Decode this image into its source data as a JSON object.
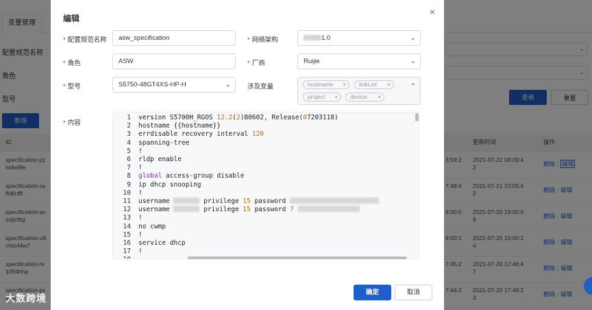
{
  "background": {
    "tab_label": "变量管理",
    "filters": [
      {
        "label": "配置规范名称"
      },
      {
        "label": "角色"
      },
      {
        "label": "型号"
      }
    ],
    "query_button": "查询",
    "reset_button": "重置",
    "new_button": "新增",
    "table": {
      "columns": [
        "ID",
        "更新时间",
        "操作"
      ],
      "rows": [
        {
          "id_line1": "specification-jzj",
          "id_line2": "hnke9le",
          "time_prev_line1": "3:59:2",
          "time_prev_line2": "",
          "updated_line1": "2021-07-22 08:09:4",
          "updated_line2": "2",
          "delete": "删除",
          "edit": "编辑"
        },
        {
          "id_line1": "specification-ox",
          "id_line2": "ffdfinfff",
          "time_prev_line1": "7:48:4",
          "time_prev_line2": "",
          "updated_line1": "2021-07-21 23:05:4",
          "updated_line2": "2",
          "delete": "删除",
          "edit": "编辑"
        },
        {
          "id_line1": "specification-au",
          "id_line2": "zojizfttg",
          "time_prev_line1": "9:00:5",
          "time_prev_line2": "",
          "updated_line1": "2021-07-20 19:00:5",
          "updated_line2": "9",
          "delete": "删除",
          "edit": "编辑"
        },
        {
          "id_line1": "specification-u9",
          "id_line2": "chio44w7",
          "time_prev_line1": "9:00:1",
          "time_prev_line2": "",
          "updated_line1": "2021-07-20 19:00:1",
          "updated_line2": "4",
          "delete": "删除",
          "edit": "编辑"
        },
        {
          "id_line1": "specification-hr",
          "id_line2": "1tf94hha",
          "time_prev_line1": "7:45:2",
          "time_prev_line2": "",
          "updated_line1": "2021-07-20 17:46:4",
          "updated_line2": "7",
          "delete": "删除",
          "edit": "编辑"
        },
        {
          "id_line1": "specification-pc",
          "id_line2": "dqxqc",
          "time_prev_line1": "7:44:2",
          "time_prev_line2": "",
          "updated_line1": "2021-07-20 17:46:2",
          "updated_line2": "3",
          "delete": "删除",
          "edit": "编辑"
        }
      ]
    }
  },
  "modal": {
    "title": "编辑",
    "close_icon": "×",
    "fields": {
      "spec_name": {
        "label": "配置规范名称",
        "required": "*",
        "value": "asw_specification"
      },
      "network_arch": {
        "label": "网络架构",
        "required": "*",
        "value": "1.0"
      },
      "role": {
        "label": "角色",
        "required": "*",
        "value": "ASW"
      },
      "vendor": {
        "label": "厂商",
        "required": "*",
        "value": "Ruijie"
      },
      "model": {
        "label": "型号",
        "required": "*",
        "value": "S5750-48GT4XS-HP-H"
      },
      "variables": {
        "label": "涉及变量",
        "tags": [
          "hostname",
          "linkList",
          "project",
          "device"
        ]
      },
      "content": {
        "label": "内容",
        "required": "*"
      }
    },
    "code_lines": [
      {
        "n": "1",
        "text": "version S5700H_RGOS 12.2(2)B0602, Release(07203118)"
      },
      {
        "n": "2",
        "text": "hostname {{hostname}}"
      },
      {
        "n": "3",
        "text": "errdisable recovery interval 120"
      },
      {
        "n": "4",
        "text": "spanning-tree"
      },
      {
        "n": "5",
        "text": "!"
      },
      {
        "n": "6",
        "text": "rldp enable"
      },
      {
        "n": "7",
        "text": "!"
      },
      {
        "n": "8",
        "text": "global access-group disable"
      },
      {
        "n": "9",
        "text": "ip dhcp snooping"
      },
      {
        "n": "10",
        "text": "!"
      },
      {
        "n": "11",
        "text": "username ______ privilege 15 password"
      },
      {
        "n": "12",
        "text": "username ______ privilege 15 password 7"
      },
      {
        "n": "13",
        "text": "!"
      },
      {
        "n": "14",
        "text": "no cwmp"
      },
      {
        "n": "15",
        "text": "!"
      },
      {
        "n": "16",
        "text": "service dhcp"
      },
      {
        "n": "17",
        "text": "!"
      },
      {
        "n": "18",
        "text": ""
      }
    ],
    "confirm_button": "确定",
    "cancel_button": "取消"
  },
  "watermark": "大数跨境",
  "colors": {
    "primary": "#1f5fcb",
    "required": "#e02020",
    "link": "#1e5fcf"
  }
}
